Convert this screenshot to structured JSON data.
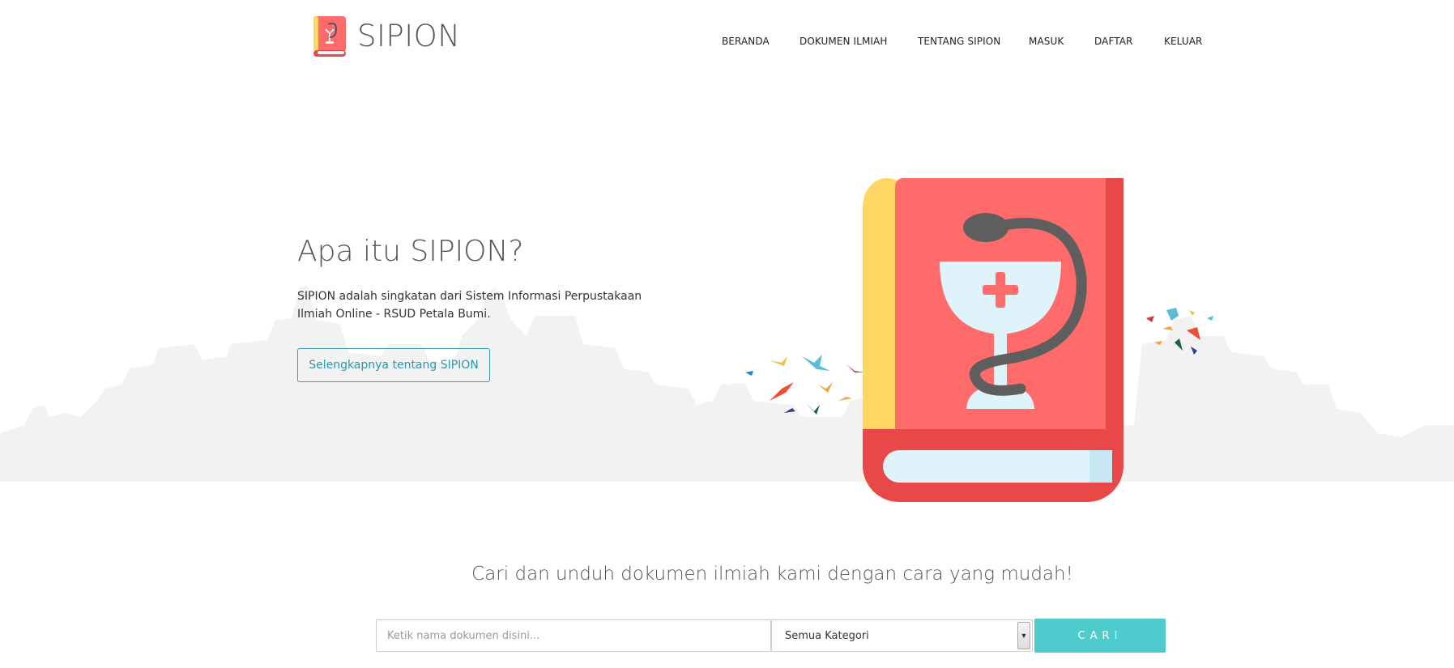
{
  "brand": {
    "name": "SIPION"
  },
  "nav": {
    "items": [
      {
        "label": "BERANDA"
      },
      {
        "label": "DOKUMEN ILMIAH"
      },
      {
        "label": "TENTANG SIPION"
      },
      {
        "label": "MASUK"
      },
      {
        "label": "DAFTAR"
      },
      {
        "label": "KELUAR"
      }
    ]
  },
  "hero": {
    "title": "Apa itu SIPION?",
    "description": "SIPION adalah singkatan dari Sistem Informasi Perpustakaan Ilmiah Online - RSUD Petala Bumi.",
    "button_label": "Selengkapnya tentang SIPION"
  },
  "search": {
    "title": "Cari dan unduh dokumen ilmiah kami dengan cara yang mudah!",
    "placeholder": "Ketik nama dokumen disini...",
    "category_selected": "Semua Kategori",
    "button_label": "CARI"
  },
  "colors": {
    "accent": "#4ecbcc",
    "book_red": "#ff6a6a",
    "book_dark_red": "#e94848",
    "book_yellow": "#ffd664",
    "pages_blue": "#dff3fb",
    "skyline_gray": "#f3f3f3"
  },
  "icons": {
    "logo": "pharmacy-book-icon",
    "select_arrow": "chevron-down-icon"
  }
}
